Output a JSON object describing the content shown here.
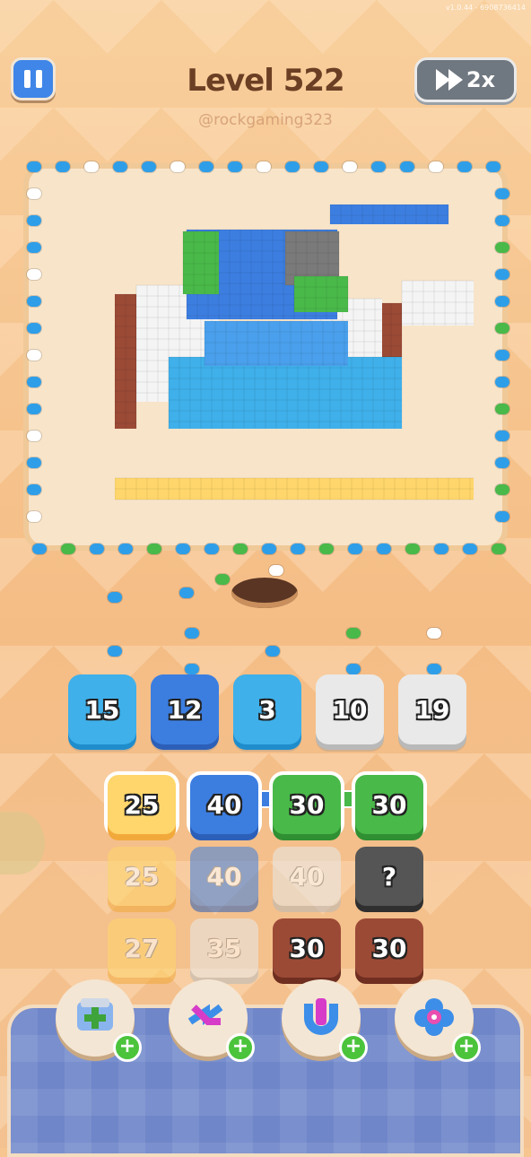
{
  "version": "v1.0.44 - 6908736414",
  "header": {
    "level_title": "Level 522",
    "handle": "@rockgaming323",
    "speed_label": "2x"
  },
  "colors": {
    "sky": "#3fb0ea",
    "blue": "#3c7ee0",
    "white": "#e9e9e9",
    "yellow": "#ffd66b",
    "green": "#49b949",
    "brown": "#9b4a36",
    "mystery": "#555555"
  },
  "queue": [
    {
      "value": "15",
      "color": "sky"
    },
    {
      "value": "12",
      "color": "blue"
    },
    {
      "value": "3",
      "color": "sky"
    },
    {
      "value": "10",
      "color": "white"
    },
    {
      "value": "19",
      "color": "white"
    }
  ],
  "grid": [
    {
      "value": "25",
      "color": "yellow",
      "active": true
    },
    {
      "value": "40",
      "color": "blue",
      "active": true
    },
    {
      "value": "30",
      "color": "green",
      "active": true
    },
    {
      "value": "30",
      "color": "green",
      "active": true
    },
    {
      "value": "25",
      "color": "yellow",
      "active": false
    },
    {
      "value": "40",
      "color": "blue",
      "active": false
    },
    {
      "value": "40",
      "color": "white",
      "active": false
    },
    {
      "value": "?",
      "color": "mystery",
      "active": true
    },
    {
      "value": "27",
      "color": "yellow",
      "active": false
    },
    {
      "value": "35",
      "color": "white",
      "active": false
    },
    {
      "value": "30",
      "color": "brown",
      "active": true
    },
    {
      "value": "30",
      "color": "brown",
      "active": true
    }
  ],
  "boosters": [
    {
      "name": "add-slot-icon",
      "badge": "+"
    },
    {
      "name": "shuffle-arrows-icon",
      "badge": "+"
    },
    {
      "name": "magnet-icon",
      "badge": "+"
    },
    {
      "name": "flower-icon",
      "badge": "+"
    }
  ]
}
